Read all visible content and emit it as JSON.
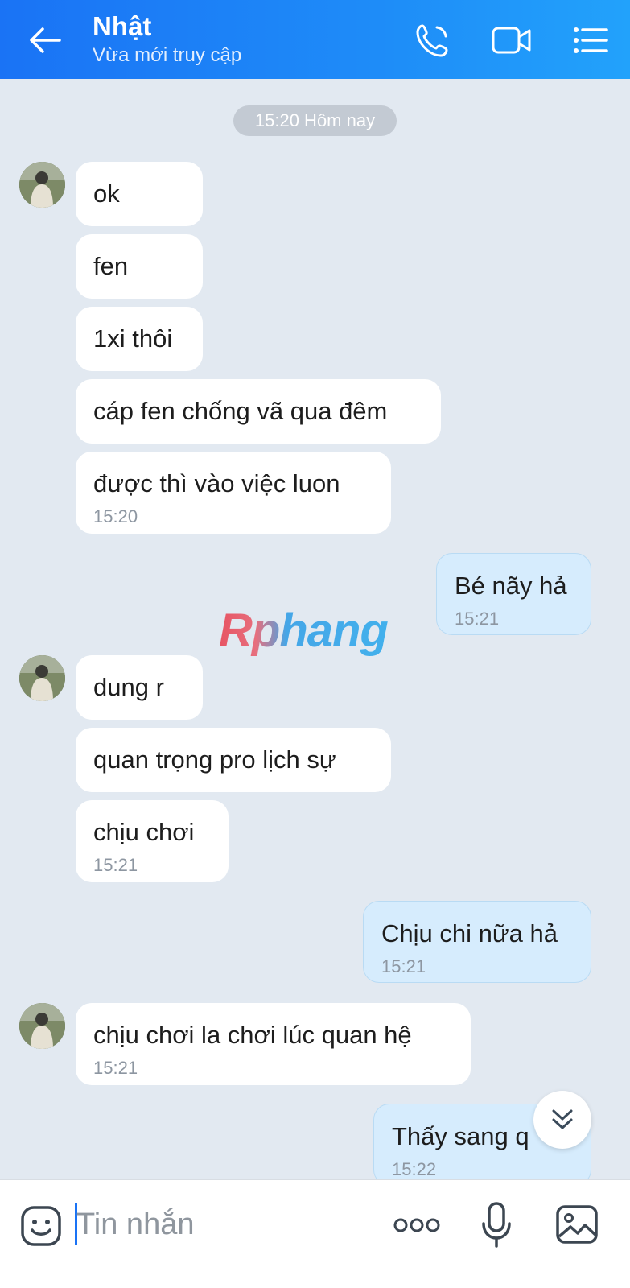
{
  "header": {
    "contact_name": "Nhật",
    "status": "Vừa mới truy cập",
    "icons": [
      "back-arrow-icon",
      "phone-icon",
      "video-camera-icon",
      "list-menu-icon"
    ]
  },
  "chat": {
    "date_separator": "15:20 Hôm nay",
    "watermark": "Rphang",
    "messages": [
      {
        "from": "contact",
        "text": "ok",
        "time": ""
      },
      {
        "from": "contact",
        "text": "fen",
        "time": ""
      },
      {
        "from": "contact",
        "text": "1xi thôi",
        "time": ""
      },
      {
        "from": "contact",
        "text": "cáp fen chống vã qua đêm",
        "time": ""
      },
      {
        "from": "contact",
        "text": " được thì vào việc luon",
        "time": "15:20"
      },
      {
        "from": "me",
        "text": "Bé nãy hả",
        "time": "15:21"
      },
      {
        "from": "contact",
        "text": "dung r",
        "time": ""
      },
      {
        "from": "contact",
        "text": "quan trọng pro lịch sự",
        "time": ""
      },
      {
        "from": "contact",
        "text": "chịu chơi",
        "time": "15:21"
      },
      {
        "from": "me",
        "text": "Chịu chi nữa hả",
        "time": "15:21"
      },
      {
        "from": "contact",
        "text": "chịu chơi la chơi lúc quan hệ",
        "time": "15:21"
      },
      {
        "from": "me",
        "text": "Thấy sang q",
        "time": "15:22"
      }
    ]
  },
  "input_bar": {
    "placeholder": "Tin nhắn",
    "icons": [
      "emoji-icon",
      "more-dots-icon",
      "microphone-icon",
      "image-icon"
    ]
  },
  "colors": {
    "header_start": "#1a73f5",
    "header_end": "#22a2fb",
    "chat_background": "#e2e9f1",
    "incoming_bubble": "#ffffff",
    "outgoing_bubble": "#d6ecfd"
  }
}
